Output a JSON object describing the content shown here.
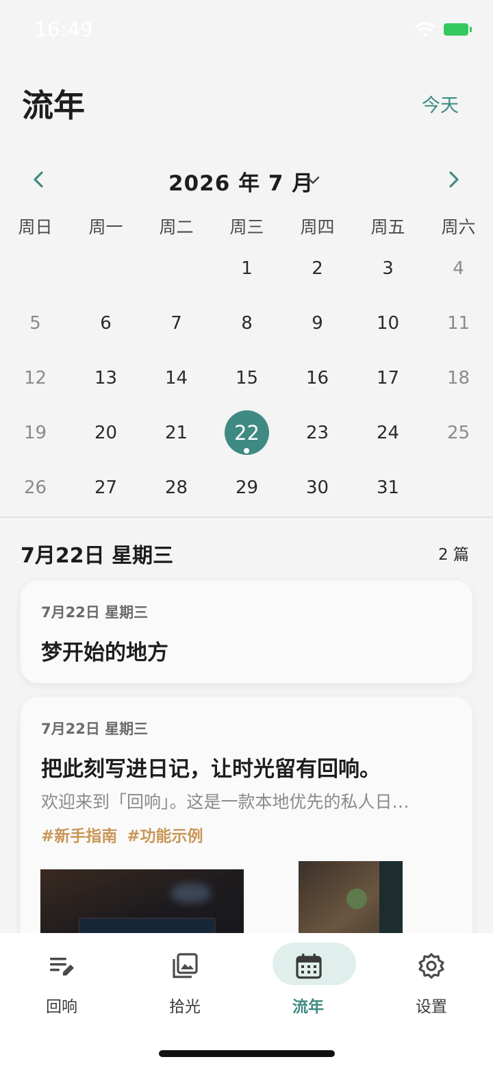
{
  "status_bar": {
    "time": "16:49"
  },
  "header": {
    "title": "流年",
    "today_label": "今天"
  },
  "calendar": {
    "month_label": "2026 年 7 月",
    "weekdays": [
      "周日",
      "周一",
      "周二",
      "周三",
      "周四",
      "周五",
      "周六"
    ],
    "weeks": [
      [
        "",
        "",
        "",
        "1",
        "2",
        "3",
        "4"
      ],
      [
        "5",
        "6",
        "7",
        "8",
        "9",
        "10",
        "11"
      ],
      [
        "12",
        "13",
        "14",
        "15",
        "16",
        "17",
        "18"
      ],
      [
        "19",
        "20",
        "21",
        "22",
        "23",
        "24",
        "25"
      ],
      [
        "26",
        "27",
        "28",
        "29",
        "30",
        "31",
        ""
      ]
    ],
    "selected_day": "22",
    "accent_color": "#3f8a82"
  },
  "day_section": {
    "heading": "7月22日 星期三",
    "count": "2 篇"
  },
  "entries": [
    {
      "date": "7月22日 星期三",
      "title": "梦开始的地方"
    },
    {
      "date": "7月22日 星期三",
      "title": "把此刻写进日记，让时光留有回响。",
      "excerpt": "欢迎来到「回响」。这是一款本地优先的私人日…",
      "tags": [
        "#新手指南",
        "#功能示例"
      ]
    }
  ],
  "tabbar": {
    "tabs": [
      {
        "label": "回响",
        "icon": "edit-list-icon"
      },
      {
        "label": "拾光",
        "icon": "photo-library-icon"
      },
      {
        "label": "流年",
        "icon": "calendar-icon"
      },
      {
        "label": "设置",
        "icon": "gear-icon"
      }
    ],
    "active_index": 2
  }
}
